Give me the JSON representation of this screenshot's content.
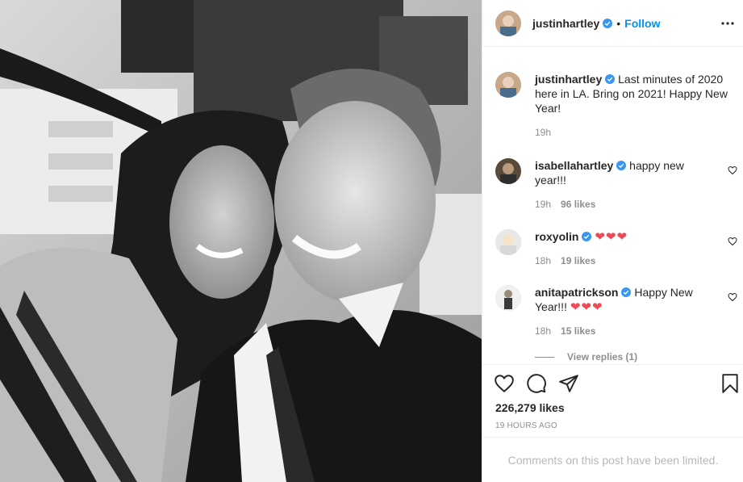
{
  "post": {
    "author": "justinhartley",
    "follow_label": "Follow",
    "dot": "•"
  },
  "caption": {
    "username": "justinhartley",
    "text": "Last minutes of 2020 here in LA. Bring on 2021! Happy New Year!",
    "time": "19h"
  },
  "comments": [
    {
      "username": "isabellahartley",
      "text": "happy new year!!!",
      "time": "19h",
      "likes": "96 likes"
    },
    {
      "username": "roxyolin",
      "text": "",
      "hearts": "❤❤❤",
      "time": "18h",
      "likes": "19 likes"
    },
    {
      "username": "anitapatrickson",
      "text": "Happy New Year!!!",
      "hearts": "❤❤❤",
      "time": "18h",
      "likes": "15 likes"
    }
  ],
  "view_replies": "View replies (1)",
  "likes_count": "226,279 likes",
  "time_ago": "19 HOURS AGO",
  "comments_limited": "Comments on this post have been limited.",
  "icons": {
    "verified": "verified-badge-icon",
    "more": "more-options-icon",
    "like": "heart-icon",
    "comment": "comment-icon",
    "share": "share-icon",
    "save": "bookmark-icon"
  },
  "colors": {
    "accent": "#0095f6",
    "verified": "#3897f0",
    "heart": "#ed4956",
    "muted": "#8e8e8e"
  }
}
